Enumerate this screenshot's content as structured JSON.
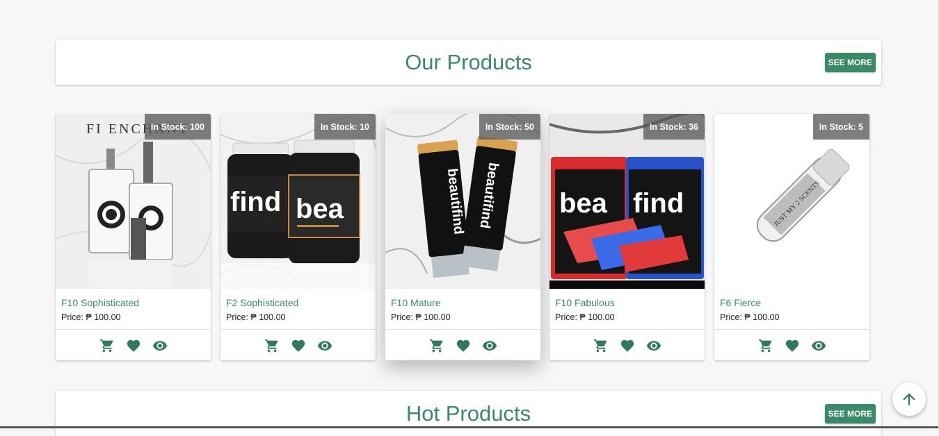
{
  "sections": {
    "our_products": {
      "title": "Our Products",
      "see_more": "SEE MORE"
    },
    "hot_products": {
      "title": "Hot Products",
      "see_more": "SEE MORE"
    }
  },
  "products": [
    {
      "name": "F10 Sophisticated",
      "price": "Price: ₱ 100.00",
      "stock": "In Stock: 100",
      "image": "perfume-bottles-image",
      "image_text": "FI ENCHANT"
    },
    {
      "name": "F2 Sophisticated",
      "price": "Price: ₱ 100.00",
      "stock": "In Stock: 10",
      "image": "supplement-bottles-image",
      "image_text": "find"
    },
    {
      "name": "F10 Mature",
      "price": "Price: ₱ 100.00",
      "stock": "In Stock: 50",
      "image": "cream-tubes-image",
      "image_text": "beautifind"
    },
    {
      "name": "F10 Fabulous",
      "price": "Price: ₱ 100.00",
      "stock": "In Stock: 36",
      "image": "soap-bars-image",
      "image_text": "find"
    },
    {
      "name": "F6 Fierce",
      "price": "Price: ₱ 100.00",
      "stock": "In Stock: 5",
      "image": "roll-on-vial-image",
      "image_text": "JUST MY 2 SCENTS"
    }
  ],
  "actions": [
    "cart-icon",
    "heart-icon",
    "eye-icon"
  ],
  "scroll_top": "arrow-up-icon",
  "colors": {
    "accent": "#3a8a6a",
    "icon": "#2f7a5c",
    "background": "#f7f7f7",
    "badge": "#5a5a5a"
  }
}
